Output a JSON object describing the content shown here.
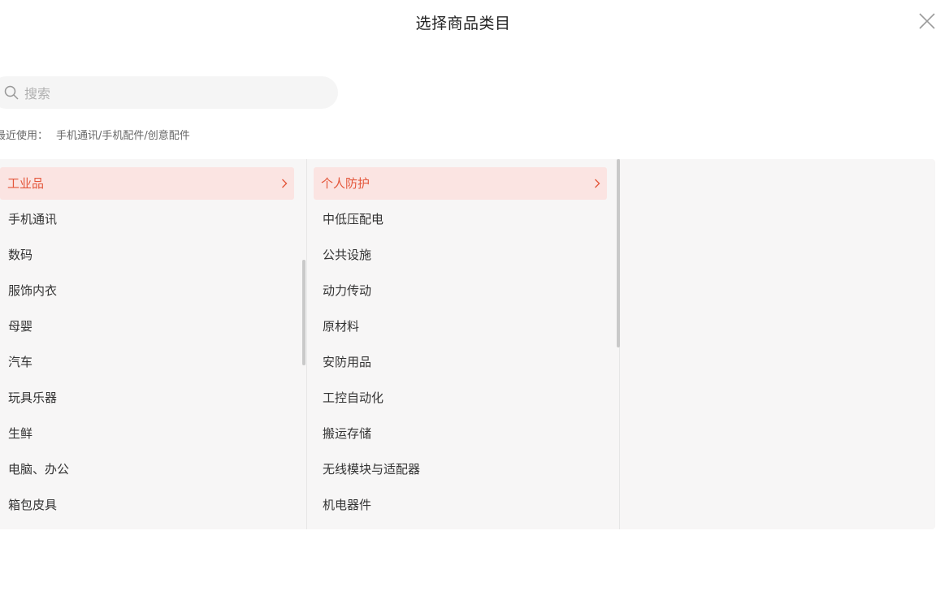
{
  "dialog": {
    "title": "选择商品类目"
  },
  "search": {
    "placeholder": "搜索",
    "value": ""
  },
  "recent": {
    "label": "最近使用：",
    "path": "手机通讯/手机配件/创意配件"
  },
  "level1": {
    "items": [
      {
        "label": "工业品",
        "active": true
      },
      {
        "label": "手机通讯"
      },
      {
        "label": "数码"
      },
      {
        "label": "服饰内衣"
      },
      {
        "label": "母婴"
      },
      {
        "label": "汽车"
      },
      {
        "label": "玩具乐器"
      },
      {
        "label": "生鲜"
      },
      {
        "label": "电脑、办公"
      },
      {
        "label": "箱包皮具"
      }
    ]
  },
  "level2": {
    "items": [
      {
        "label": "个人防护",
        "active": true
      },
      {
        "label": "中低压配电"
      },
      {
        "label": "公共设施"
      },
      {
        "label": "动力传动"
      },
      {
        "label": "原材料"
      },
      {
        "label": "安防用品"
      },
      {
        "label": "工控自动化"
      },
      {
        "label": "搬运存储"
      },
      {
        "label": "无线模块与适配器"
      },
      {
        "label": "机电器件"
      }
    ]
  },
  "colors": {
    "accent": "#e4573c",
    "active_bg": "#fbe4e2",
    "panel_bg": "#f7f6f6"
  },
  "icons": {
    "close": "close-icon",
    "search": "search-icon",
    "chevron": "chevron-right-icon"
  }
}
